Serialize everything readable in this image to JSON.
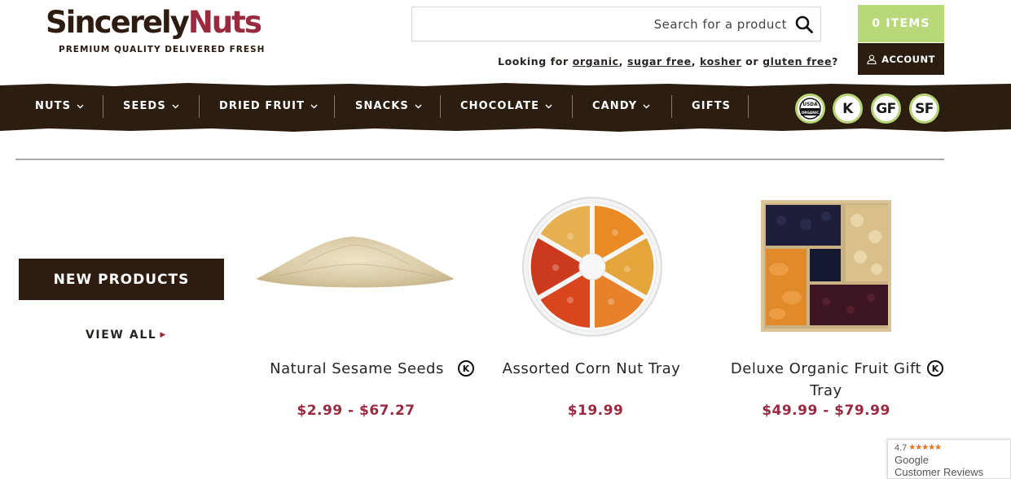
{
  "brand": {
    "name_part1": "Sincerely",
    "name_part2": "Nuts",
    "tagline": "PREMIUM QUALITY DELIVERED FRESH"
  },
  "search": {
    "placeholder": "Search for a product",
    "icon": "search-icon"
  },
  "looking_for": {
    "prefix": "Looking for ",
    "links": [
      "organic",
      "sugar free",
      "kosher",
      "gluten free"
    ],
    "sep1": ", ",
    "sep2": ", ",
    "or": " or ",
    "suffix": "?"
  },
  "cart": {
    "label": "0 ITEMS"
  },
  "account": {
    "label": "ACCOUNT",
    "icon": "user-icon"
  },
  "nav": {
    "items": [
      {
        "label": "NUTS",
        "dropdown": true
      },
      {
        "label": "SEEDS",
        "dropdown": true
      },
      {
        "label": "DRIED FRUIT",
        "dropdown": true
      },
      {
        "label": "SNACKS",
        "dropdown": true
      },
      {
        "label": "CHOCOLATE",
        "dropdown": true
      },
      {
        "label": "CANDY",
        "dropdown": true
      },
      {
        "label": "GIFTS",
        "dropdown": false
      }
    ],
    "badges": [
      {
        "label": "USDA ORGANIC",
        "line1": "USDA",
        "line2": "ORGANIC"
      },
      {
        "label": "K"
      },
      {
        "label": "GF"
      },
      {
        "label": "SF"
      }
    ]
  },
  "new_products": {
    "heading": "NEW PRODUCTS",
    "view_all": "VIEW ALL"
  },
  "products": [
    {
      "name": "Natural Sesame Seeds",
      "price": "$2.99 - $67.27",
      "kosher": true,
      "kosher_mark": "K"
    },
    {
      "name": "Assorted Corn Nut Tray",
      "price": "$19.99",
      "kosher": false
    },
    {
      "name_line1": "Deluxe Organic Fruit Gift",
      "name_line2": "Tray",
      "price": "$49.99 - $79.99",
      "kosher": true,
      "kosher_mark": "K"
    }
  ],
  "reviews": {
    "rating": "4.7",
    "stars": "★★★★★",
    "line1": "Google",
    "line2": "Customer Reviews"
  },
  "colors": {
    "brand_dark": "#2e1c10",
    "brand_red": "#9a2a3f",
    "accent_green": "#b8d87a"
  }
}
